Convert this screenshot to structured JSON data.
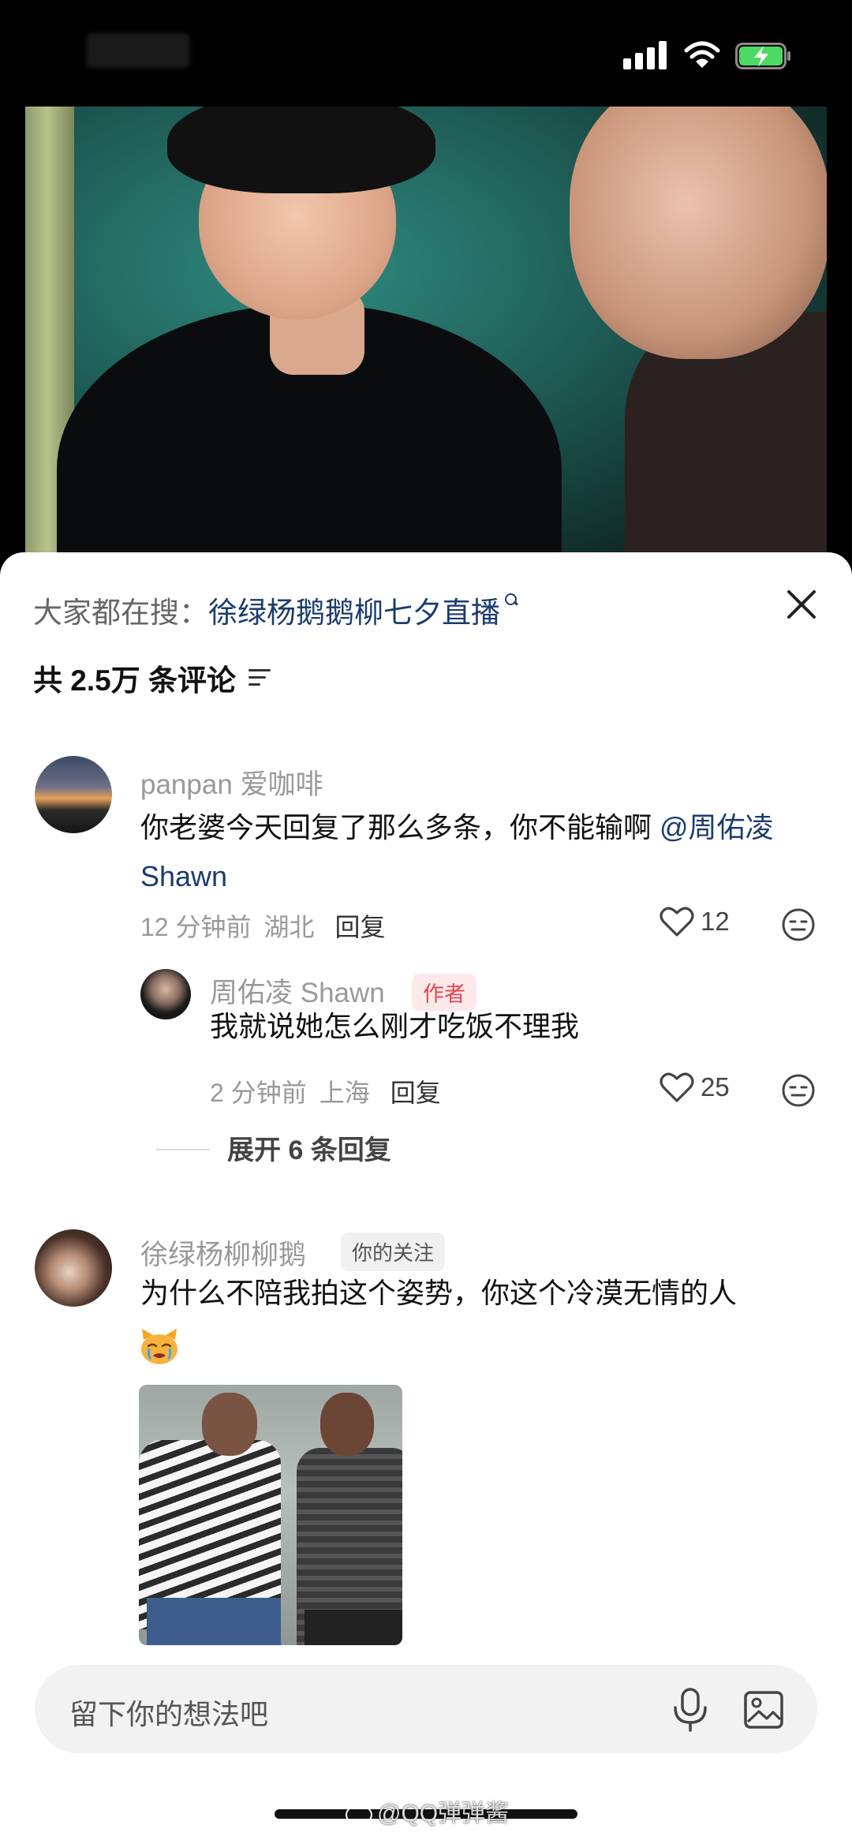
{
  "status_bar": {
    "signal": "signal-bars",
    "wifi": "wifi",
    "battery": "battery-charging"
  },
  "search": {
    "prefix": "大家都在搜：",
    "term": "徐绿杨鹅鹅柳七夕直播"
  },
  "comments_header": {
    "count_label": "共 2.5万 条评论"
  },
  "comments": [
    {
      "username": "panpan 爱咖啡",
      "content": "你老婆今天回复了那么多条，你不能输啊 ",
      "mention": "@周佑凌 Shawn",
      "time": "12 分钟前",
      "location": "湖北",
      "reply_label": "回复",
      "likes": "12"
    }
  ],
  "reply": {
    "username": "周佑凌 Shawn",
    "badge": "作者",
    "content": "我就说她怎么刚才吃饭不理我",
    "time": "2 分钟前",
    "location": "上海",
    "reply_label": "回复",
    "likes": "25"
  },
  "expand_replies": "展开 6 条回复",
  "comment2": {
    "username": "徐绿杨柳柳鹅",
    "badge": "你的关注",
    "content": "为什么不陪我拍这个姿势，你这个冷漠无情的人"
  },
  "input": {
    "placeholder": "留下你的想法吧"
  },
  "watermark": "@QQ弹弹酱",
  "colors": {
    "mention": "#1b3c6e",
    "author_badge": "#e5484d",
    "battery": "#4cd964"
  }
}
